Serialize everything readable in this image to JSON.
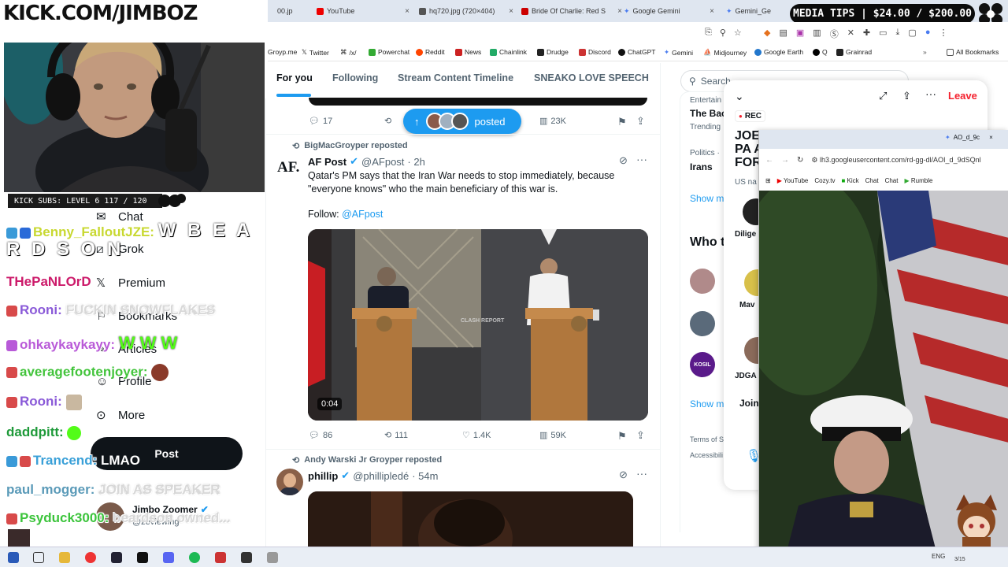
{
  "stream": {
    "url_banner": "KICK.COM/JIMBOZ",
    "subs_label": "KICK SUBS: LEVEL 6 117 / 120",
    "media_tips": "MEDIA TIPS | $24.00 / $200.00"
  },
  "tabs": [
    {
      "label": "00.jp",
      "color": "#888"
    },
    {
      "label": "YouTube",
      "color": "#e00"
    },
    {
      "label": "hq720.jpg (720×404)",
      "color": "#555"
    },
    {
      "label": "Bride Of Charlie: Red S",
      "color": "#c00"
    },
    {
      "label": "Google Gemini",
      "color": "#4a7cf0"
    },
    {
      "label": "Gemini_Ge",
      "color": "#4a7cf0"
    }
  ],
  "bookmarks": [
    {
      "label": "Groyp.me",
      "color": "#999"
    },
    {
      "label": "Twitter",
      "color": "#000"
    },
    {
      "label": "/x/",
      "color": "#333"
    },
    {
      "label": "Powerchat",
      "color": "#3a3"
    },
    {
      "label": "Reddit",
      "color": "#f40"
    },
    {
      "label": "News",
      "color": "#c22"
    },
    {
      "label": "Chainlink",
      "color": "#2a6"
    },
    {
      "label": "Drudge",
      "color": "#222"
    },
    {
      "label": "Discord",
      "color": "#c33"
    },
    {
      "label": "ChatGPT",
      "color": "#111"
    },
    {
      "label": "Gemini",
      "color": "#4a7cf0"
    },
    {
      "label": "Midjourney",
      "color": "#333"
    },
    {
      "label": "Google Earth",
      "color": "#27c"
    },
    {
      "label": "Q",
      "color": "#000"
    },
    {
      "label": "Grainrad",
      "color": "#222"
    },
    {
      "label": "All Bookmarks",
      "color": "#555"
    }
  ],
  "x_nav": {
    "tabs": [
      "For you",
      "Following",
      "Stream Content Timeline",
      "SNEAKO LOVE SPEECH"
    ]
  },
  "sidebar": {
    "items": [
      "Chat",
      "Grok",
      "Premium",
      "Bookmarks",
      "Articles",
      "Profile",
      "More"
    ],
    "post_button": "Post",
    "account_name": "Jimbo Zoomer",
    "account_handle": "@zeviewing"
  },
  "feed": {
    "top_stats": {
      "replies": "17",
      "views": "23K"
    },
    "posted_pill": "posted",
    "post1": {
      "repost_by": "BigMacGroyper reposted",
      "name": "AF Post",
      "handle": "@AFpost",
      "time": "· 2h",
      "avatar_text": "AF.",
      "text": "Qatar's PM says that the Iran War needs to stop immediately, because \"everyone knows\" who the main beneficiary of this war is.",
      "follow_label": "Follow:",
      "follow_handle": "@AFpost",
      "video_time": "0:04",
      "watermark": "CLASH REPORT",
      "replies": "86",
      "reposts": "111",
      "likes": "1.4K",
      "views": "59K"
    },
    "post2": {
      "repost_by": "Andy Warski Jr Groyper reposted",
      "name": "phillip",
      "handle": "@phillipledé",
      "time": "· 54m"
    }
  },
  "right_col": {
    "search_placeholder": "Search",
    "trend1_cat": "Entertain",
    "trend1_title": "The Bac",
    "trend1_sub": "Trending",
    "trend2_cat": "Politics ·",
    "trend2_title": "Irans",
    "show_more": "Show m",
    "who_to_follow": "Who t",
    "terms": "Terms of S",
    "accessibility": "Accessibili",
    "show_more2": "Show m"
  },
  "space": {
    "leave": "Leave",
    "rec": "REC",
    "title_lines": [
      "JOE",
      "PA A",
      "FOR"
    ],
    "sub": "US na",
    "names": [
      "Dilige",
      "Mav",
      "JDGA"
    ],
    "join": "Join"
  },
  "popup": {
    "tab_label": "AO_d_9c",
    "url": "lh3.googleusercontent.com/rd-gg-dl/AOI_d_9dSQnl",
    "bookmarks": [
      "YouTube",
      "Cozy.tv",
      "Kick",
      "Chat",
      "Chat",
      "Rumble"
    ]
  },
  "chat": [
    {
      "user": "Benny_FalloutJZE:",
      "user_color": "#c8d830",
      "msg": "W B E A",
      "msg2": "R D S O N"
    },
    {
      "user": "THePaNLOrD",
      "user_color": "#cc1a6a",
      "msg": ""
    },
    {
      "user": "Rooni:",
      "user_color": "#8a5ad8",
      "msg": "FUCKIN SNOWFLAKES"
    },
    {
      "user": "ohkaykaykayy:",
      "user_color": "#b95ad8",
      "msg": "W W W"
    },
    {
      "user": "averagefootenjoyer:",
      "user_color": "#43c43c",
      "msg": ""
    },
    {
      "user": "Rooni:",
      "user_color": "#8a5ad8",
      "msg": ""
    },
    {
      "user": "daddpitt:",
      "user_color": "#1f9a3a",
      "msg": ""
    },
    {
      "user": "Trancend:",
      "user_color": "#3aa0d8",
      "msg": "LMAO"
    },
    {
      "user": "paul_mogger:",
      "user_color": "#5a9ab8",
      "msg": "JOIN AS SPEAKER"
    },
    {
      "user": "Psyduck3000:",
      "user_color": "#3cc43c",
      "msg": "beardson owned..."
    }
  ],
  "taskbar": {
    "lang": "ENG",
    "date": "3/15"
  },
  "colors": {
    "x_blue": "#1d9bf0",
    "leave_red": "#f4212e",
    "kick_green": "#53fc18"
  }
}
